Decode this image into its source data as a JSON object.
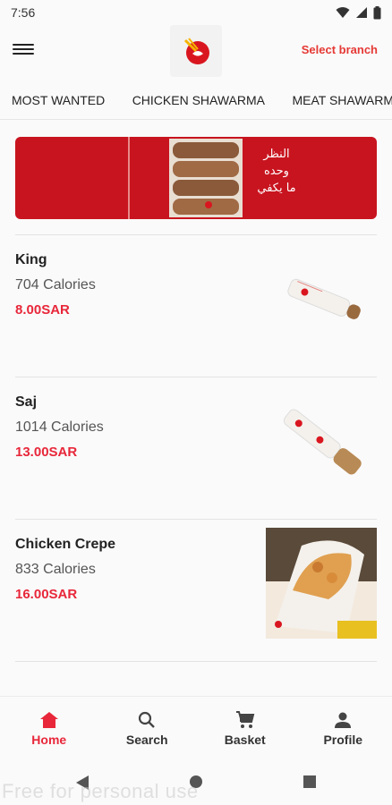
{
  "status_bar": {
    "time": "7:56"
  },
  "header": {
    "select_branch": "Select branch"
  },
  "tabs": [
    {
      "label": "MOST WANTED",
      "active": true
    },
    {
      "label": "CHICKEN SHAWARMA",
      "active": false
    },
    {
      "label": "MEAT SHAWARMA",
      "active": false
    }
  ],
  "banner": {
    "text_line1": "النظر",
    "text_line2": "وحده",
    "text_line3": "ما يكفي"
  },
  "items": [
    {
      "name": "King",
      "calories": "704 Calories",
      "price": "8.00SAR"
    },
    {
      "name": "Saj",
      "calories": "1014 Calories",
      "price": "13.00SAR"
    },
    {
      "name": "Chicken Crepe",
      "calories": "833 Calories",
      "price": "16.00SAR"
    }
  ],
  "bottom_nav": [
    {
      "label": "Home",
      "active": true,
      "icon": "home-icon"
    },
    {
      "label": "Search",
      "active": false,
      "icon": "search-icon"
    },
    {
      "label": "Basket",
      "active": false,
      "icon": "cart-icon"
    },
    {
      "label": "Profile",
      "active": false,
      "icon": "person-icon"
    }
  ],
  "watermark": "Free for personal use",
  "colors": {
    "accent": "#e8273a",
    "banner_red": "#c8141f",
    "tab_indicator": "#f18a8a"
  }
}
